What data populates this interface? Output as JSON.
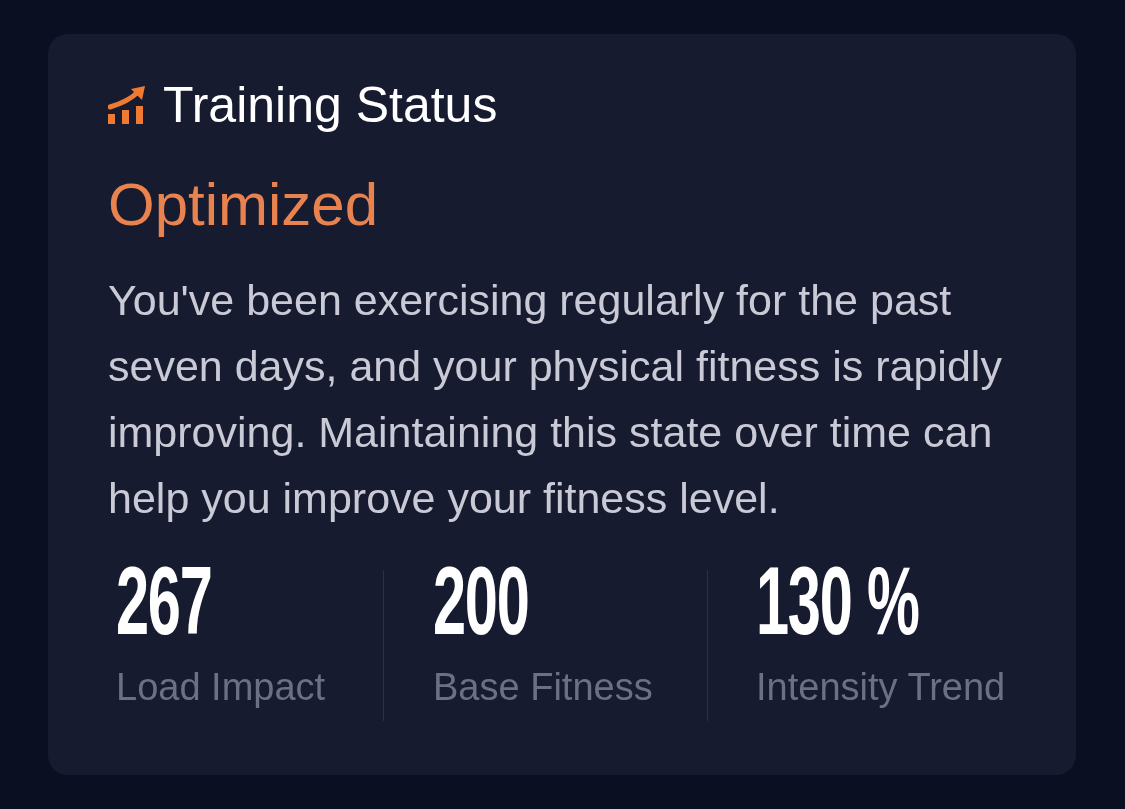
{
  "card": {
    "title": "Training Status",
    "status": "Optimized",
    "description": "You've been exercising regularly for the past seven days, and your physical fitness is rapidly improving. Maintaining this state over time can help you improve your fitness level.",
    "stats": [
      {
        "value": "267",
        "label": "Load Impact"
      },
      {
        "value": "200",
        "label": "Base Fitness"
      },
      {
        "value": "130 %",
        "label": "Intensity Trend"
      }
    ]
  }
}
